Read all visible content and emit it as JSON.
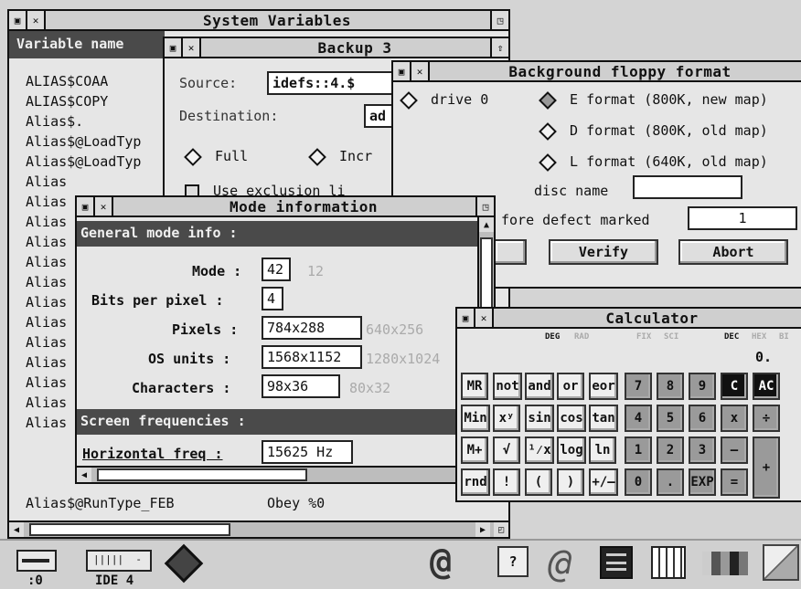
{
  "sysvars": {
    "title": "System Variables",
    "column_header": "Variable name",
    "rows": [
      "ALIAS$COAA",
      "ALIAS$COPY",
      "Alias$.",
      "Alias$@LoadTyp",
      "Alias$@LoadTyp",
      "Alias",
      "Alias",
      "Alias",
      "Alias",
      "Alias",
      "Alias",
      "Alias",
      "Alias",
      "Alias",
      "Alias",
      "Alias",
      "Alias",
      "Alias"
    ],
    "last_row_name": "Alias$@RunType_FEB",
    "last_row_value": "Obey %0"
  },
  "backup": {
    "title": "Backup 3",
    "source_label": "Source:",
    "source_value": "idefs::4.$",
    "destination_label": "Destination:",
    "destination_value": "ad",
    "full_label": "Full",
    "incr_label": "Incr",
    "use_exclusion_label": "Use exclusion li"
  },
  "floppy": {
    "title": "Background floppy format",
    "drive_label": "drive 0",
    "e_format": "E format (800K, new map)",
    "d_format": "D format (800K, old map)",
    "l_format": "L format (640K, old map)",
    "disc_name_label": "disc name",
    "defect_label": "fore defect marked",
    "defect_value": "1",
    "verify_label": "Verify",
    "abort_label": "Abort"
  },
  "modeinfo": {
    "title": "Mode information",
    "general_header": "General mode info :",
    "mode_label": "Mode :",
    "mode_value": "42",
    "mode_alt": "12",
    "bpp_label": "Bits per pixel :",
    "bpp_value": "4",
    "pixels_label": "Pixels :",
    "pixels_value": "784x288",
    "pixels_alt": "640x256",
    "os_label": "OS units :",
    "os_value": "1568x1152",
    "os_alt": "1280x1024",
    "chars_label": "Characters :",
    "chars_value": "98x36",
    "chars_alt": "80x32",
    "freq_header": "Screen frequencies :",
    "hfreq_label": "Horizontal freq :",
    "hfreq_value": "15625 Hz"
  },
  "calculator": {
    "title": "Calculator",
    "indicators": [
      "DEG",
      "RAD",
      "FIX",
      "SCI",
      "DEC",
      "HEX",
      "BI"
    ],
    "display": "0.",
    "rows": [
      [
        "MR",
        "not",
        "and",
        "or",
        "eor",
        "7",
        "8",
        "9",
        "C",
        "AC"
      ],
      [
        "Min",
        "xʸ",
        "sin",
        "cos",
        "tan",
        "4",
        "5",
        "6",
        "x",
        "÷"
      ],
      [
        "M+",
        "√",
        "¹⁄x",
        "log",
        "ln",
        "1",
        "2",
        "3",
        "–",
        "+"
      ],
      [
        "rnd",
        "!",
        "(",
        ")",
        "+/–",
        "0",
        ".",
        "EXP",
        "="
      ]
    ]
  },
  "iconbar": {
    "drive_label": ":0",
    "ide_label": "IDE 4"
  }
}
